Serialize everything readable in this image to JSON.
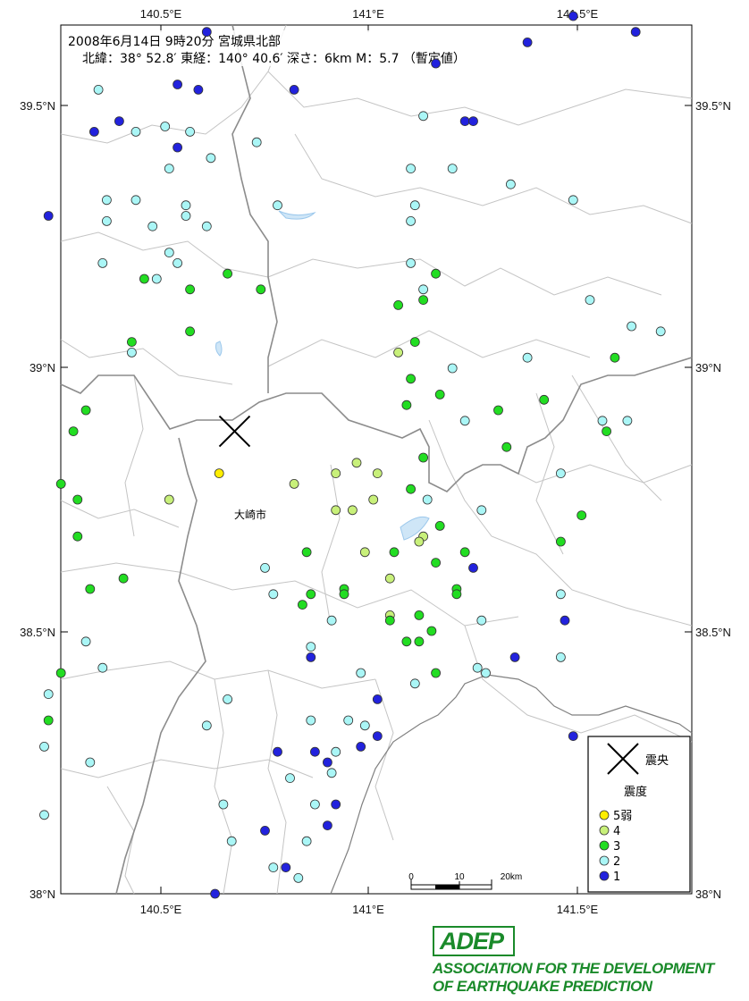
{
  "header": {
    "line1": "2008年6月14日 9時20分  宮城県北部",
    "line2": "北緯：38° 52.8′ 東経：140° 40.6′ 深さ：6km  M：5.7  （暫定値）"
  },
  "axes": {
    "top_ticks": [
      "140.5°E",
      "141°E",
      "141.5°E"
    ],
    "bottom_ticks": [
      "140.5°E",
      "141°E",
      "141.5°E"
    ],
    "left_ticks": [
      "39.5°N",
      "39°N",
      "38.5°N",
      "38°N"
    ],
    "right_ticks": [
      "39.5°N",
      "39°N",
      "38.5°N",
      "38°N"
    ]
  },
  "place_label": "大崎市",
  "epicenter": {
    "lat": 38.88,
    "lon": 140.677
  },
  "legend": {
    "epicenter_label": "震央",
    "intensity_title": "震度",
    "items": [
      {
        "label": "5弱",
        "color": "#ffee00"
      },
      {
        "label": "4",
        "color": "#c8f07a"
      },
      {
        "label": "3",
        "color": "#22dd22"
      },
      {
        "label": "2",
        "color": "#aaf6f6"
      },
      {
        "label": "1",
        "color": "#2222dd"
      }
    ]
  },
  "scale_bar": {
    "labels": [
      "0",
      "10",
      "20km"
    ]
  },
  "logo": {
    "mark": "ADEP",
    "line1": "ASSOCIATION  FOR THE DEVELOPMENT",
    "line2": "OF EARTHQUAKE PREDICTION",
    "color": "#1a8a2a"
  },
  "stations": [
    {
      "lon": 140.61,
      "lat": 39.64,
      "i": 1
    },
    {
      "lon": 141.38,
      "lat": 39.62,
      "i": 1
    },
    {
      "lon": 141.49,
      "lat": 39.67,
      "i": 1
    },
    {
      "lon": 141.64,
      "lat": 39.64,
      "i": 1
    },
    {
      "lon": 140.35,
      "lat": 39.53,
      "i": 2
    },
    {
      "lon": 140.54,
      "lat": 39.54,
      "i": 1
    },
    {
      "lon": 140.59,
      "lat": 39.53,
      "i": 1
    },
    {
      "lon": 140.82,
      "lat": 39.53,
      "i": 1
    },
    {
      "lon": 141.16,
      "lat": 39.58,
      "i": 1
    },
    {
      "lon": 140.4,
      "lat": 39.47,
      "i": 1
    },
    {
      "lon": 140.34,
      "lat": 39.45,
      "i": 1
    },
    {
      "lon": 140.44,
      "lat": 39.45,
      "i": 2
    },
    {
      "lon": 140.51,
      "lat": 39.46,
      "i": 2
    },
    {
      "lon": 140.57,
      "lat": 39.45,
      "i": 2
    },
    {
      "lon": 141.23,
      "lat": 39.47,
      "i": 1
    },
    {
      "lon": 141.25,
      "lat": 39.47,
      "i": 1
    },
    {
      "lon": 141.13,
      "lat": 39.48,
      "i": 2
    },
    {
      "lon": 140.54,
      "lat": 39.42,
      "i": 1
    },
    {
      "lon": 140.73,
      "lat": 39.43,
      "i": 2
    },
    {
      "lon": 140.52,
      "lat": 39.38,
      "i": 2
    },
    {
      "lon": 140.62,
      "lat": 39.4,
      "i": 2
    },
    {
      "lon": 141.1,
      "lat": 39.38,
      "i": 2
    },
    {
      "lon": 141.2,
      "lat": 39.38,
      "i": 2
    },
    {
      "lon": 141.34,
      "lat": 39.35,
      "i": 2
    },
    {
      "lon": 140.37,
      "lat": 39.32,
      "i": 2
    },
    {
      "lon": 140.44,
      "lat": 39.32,
      "i": 2
    },
    {
      "lon": 140.56,
      "lat": 39.31,
      "i": 2
    },
    {
      "lon": 140.23,
      "lat": 39.29,
      "i": 1
    },
    {
      "lon": 140.56,
      "lat": 39.29,
      "i": 2
    },
    {
      "lon": 140.78,
      "lat": 39.31,
      "i": 2
    },
    {
      "lon": 141.11,
      "lat": 39.31,
      "i": 2
    },
    {
      "lon": 141.49,
      "lat": 39.32,
      "i": 2
    },
    {
      "lon": 140.37,
      "lat": 39.28,
      "i": 2
    },
    {
      "lon": 140.48,
      "lat": 39.27,
      "i": 2
    },
    {
      "lon": 140.61,
      "lat": 39.27,
      "i": 2
    },
    {
      "lon": 141.1,
      "lat": 39.28,
      "i": 2
    },
    {
      "lon": 140.52,
      "lat": 39.22,
      "i": 2
    },
    {
      "lon": 140.36,
      "lat": 39.2,
      "i": 2
    },
    {
      "lon": 140.54,
      "lat": 39.2,
      "i": 2
    },
    {
      "lon": 140.66,
      "lat": 39.18,
      "i": 3
    },
    {
      "lon": 141.1,
      "lat": 39.2,
      "i": 2
    },
    {
      "lon": 141.16,
      "lat": 39.18,
      "i": 3
    },
    {
      "lon": 140.46,
      "lat": 39.17,
      "i": 3
    },
    {
      "lon": 140.49,
      "lat": 39.17,
      "i": 2
    },
    {
      "lon": 140.57,
      "lat": 39.15,
      "i": 3
    },
    {
      "lon": 140.74,
      "lat": 39.15,
      "i": 3
    },
    {
      "lon": 141.13,
      "lat": 39.15,
      "i": 2
    },
    {
      "lon": 141.13,
      "lat": 39.13,
      "i": 3
    },
    {
      "lon": 141.53,
      "lat": 39.13,
      "i": 2
    },
    {
      "lon": 141.07,
      "lat": 39.12,
      "i": 3
    },
    {
      "lon": 140.57,
      "lat": 39.07,
      "i": 3
    },
    {
      "lon": 141.63,
      "lat": 39.08,
      "i": 2
    },
    {
      "lon": 141.7,
      "lat": 39.07,
      "i": 2
    },
    {
      "lon": 140.43,
      "lat": 39.05,
      "i": 3
    },
    {
      "lon": 141.11,
      "lat": 39.05,
      "i": 3
    },
    {
      "lon": 140.43,
      "lat": 39.03,
      "i": 2
    },
    {
      "lon": 141.07,
      "lat": 39.03,
      "i": 4
    },
    {
      "lon": 141.38,
      "lat": 39.02,
      "i": 2
    },
    {
      "lon": 141.59,
      "lat": 39.02,
      "i": 3
    },
    {
      "lon": 141.2,
      "lat": 39.0,
      "i": 2
    },
    {
      "lon": 141.1,
      "lat": 38.98,
      "i": 3
    },
    {
      "lon": 141.17,
      "lat": 38.95,
      "i": 3
    },
    {
      "lon": 141.42,
      "lat": 38.94,
      "i": 3
    },
    {
      "lon": 140.32,
      "lat": 38.92,
      "i": 3
    },
    {
      "lon": 141.09,
      "lat": 38.93,
      "i": 3
    },
    {
      "lon": 141.31,
      "lat": 38.92,
      "i": 3
    },
    {
      "lon": 141.23,
      "lat": 38.9,
      "i": 2
    },
    {
      "lon": 141.56,
      "lat": 38.9,
      "i": 2
    },
    {
      "lon": 141.62,
      "lat": 38.9,
      "i": 2
    },
    {
      "lon": 140.29,
      "lat": 38.88,
      "i": 3
    },
    {
      "lon": 141.57,
      "lat": 38.88,
      "i": 3
    },
    {
      "lon": 141.33,
      "lat": 38.85,
      "i": 3
    },
    {
      "lon": 140.97,
      "lat": 38.82,
      "i": 4
    },
    {
      "lon": 141.13,
      "lat": 38.83,
      "i": 3
    },
    {
      "lon": 140.64,
      "lat": 38.8,
      "i": 5
    },
    {
      "lon": 140.92,
      "lat": 38.8,
      "i": 4
    },
    {
      "lon": 141.02,
      "lat": 38.8,
      "i": 4
    },
    {
      "lon": 141.46,
      "lat": 38.8,
      "i": 2
    },
    {
      "lon": 140.26,
      "lat": 38.78,
      "i": 3
    },
    {
      "lon": 140.82,
      "lat": 38.78,
      "i": 4
    },
    {
      "lon": 141.1,
      "lat": 38.77,
      "i": 3
    },
    {
      "lon": 140.3,
      "lat": 38.75,
      "i": 3
    },
    {
      "lon": 140.52,
      "lat": 38.75,
      "i": 4
    },
    {
      "lon": 141.01,
      "lat": 38.75,
      "i": 4
    },
    {
      "lon": 141.14,
      "lat": 38.75,
      "i": 2
    },
    {
      "lon": 140.92,
      "lat": 38.73,
      "i": 4
    },
    {
      "lon": 140.96,
      "lat": 38.73,
      "i": 4
    },
    {
      "lon": 141.27,
      "lat": 38.73,
      "i": 2
    },
    {
      "lon": 141.51,
      "lat": 38.72,
      "i": 3
    },
    {
      "lon": 141.17,
      "lat": 38.7,
      "i": 3
    },
    {
      "lon": 140.3,
      "lat": 38.68,
      "i": 3
    },
    {
      "lon": 141.13,
      "lat": 38.68,
      "i": 4
    },
    {
      "lon": 141.12,
      "lat": 38.67,
      "i": 4
    },
    {
      "lon": 141.46,
      "lat": 38.67,
      "i": 3
    },
    {
      "lon": 140.85,
      "lat": 38.65,
      "i": 3
    },
    {
      "lon": 140.99,
      "lat": 38.65,
      "i": 4
    },
    {
      "lon": 141.06,
      "lat": 38.65,
      "i": 3
    },
    {
      "lon": 141.23,
      "lat": 38.65,
      "i": 3
    },
    {
      "lon": 141.16,
      "lat": 38.63,
      "i": 3
    },
    {
      "lon": 140.75,
      "lat": 38.62,
      "i": 2
    },
    {
      "lon": 141.25,
      "lat": 38.62,
      "i": 1
    },
    {
      "lon": 140.41,
      "lat": 38.6,
      "i": 3
    },
    {
      "lon": 141.05,
      "lat": 38.6,
      "i": 4
    },
    {
      "lon": 140.33,
      "lat": 38.58,
      "i": 3
    },
    {
      "lon": 140.94,
      "lat": 38.58,
      "i": 3
    },
    {
      "lon": 141.21,
      "lat": 38.58,
      "i": 3
    },
    {
      "lon": 140.77,
      "lat": 38.57,
      "i": 2
    },
    {
      "lon": 140.86,
      "lat": 38.57,
      "i": 3
    },
    {
      "lon": 140.94,
      "lat": 38.57,
      "i": 3
    },
    {
      "lon": 141.21,
      "lat": 38.57,
      "i": 3
    },
    {
      "lon": 141.46,
      "lat": 38.57,
      "i": 2
    },
    {
      "lon": 140.84,
      "lat": 38.55,
      "i": 3
    },
    {
      "lon": 141.05,
      "lat": 38.53,
      "i": 4
    },
    {
      "lon": 141.12,
      "lat": 38.53,
      "i": 3
    },
    {
      "lon": 140.91,
      "lat": 38.52,
      "i": 2
    },
    {
      "lon": 141.05,
      "lat": 38.52,
      "i": 3
    },
    {
      "lon": 141.27,
      "lat": 38.52,
      "i": 2
    },
    {
      "lon": 141.47,
      "lat": 38.52,
      "i": 1
    },
    {
      "lon": 141.15,
      "lat": 38.5,
      "i": 3
    },
    {
      "lon": 140.32,
      "lat": 38.48,
      "i": 2
    },
    {
      "lon": 141.09,
      "lat": 38.48,
      "i": 3
    },
    {
      "lon": 141.12,
      "lat": 38.48,
      "i": 3
    },
    {
      "lon": 140.86,
      "lat": 38.47,
      "i": 2
    },
    {
      "lon": 140.86,
      "lat": 38.45,
      "i": 1
    },
    {
      "lon": 141.35,
      "lat": 38.45,
      "i": 1
    },
    {
      "lon": 141.46,
      "lat": 38.45,
      "i": 2
    },
    {
      "lon": 140.36,
      "lat": 38.43,
      "i": 2
    },
    {
      "lon": 141.26,
      "lat": 38.43,
      "i": 2
    },
    {
      "lon": 140.26,
      "lat": 38.42,
      "i": 3
    },
    {
      "lon": 140.98,
      "lat": 38.42,
      "i": 2
    },
    {
      "lon": 141.16,
      "lat": 38.42,
      "i": 3
    },
    {
      "lon": 141.28,
      "lat": 38.42,
      "i": 2
    },
    {
      "lon": 141.11,
      "lat": 38.4,
      "i": 2
    },
    {
      "lon": 140.23,
      "lat": 38.38,
      "i": 2
    },
    {
      "lon": 140.66,
      "lat": 38.37,
      "i": 2
    },
    {
      "lon": 141.02,
      "lat": 38.37,
      "i": 1
    },
    {
      "lon": 140.23,
      "lat": 38.33,
      "i": 3
    },
    {
      "lon": 140.86,
      "lat": 38.33,
      "i": 2
    },
    {
      "lon": 140.95,
      "lat": 38.33,
      "i": 2
    },
    {
      "lon": 140.61,
      "lat": 38.32,
      "i": 2
    },
    {
      "lon": 140.99,
      "lat": 38.32,
      "i": 2
    },
    {
      "lon": 141.02,
      "lat": 38.3,
      "i": 1
    },
    {
      "lon": 141.49,
      "lat": 38.3,
      "i": 1
    },
    {
      "lon": 140.22,
      "lat": 38.28,
      "i": 2
    },
    {
      "lon": 140.98,
      "lat": 38.28,
      "i": 1
    },
    {
      "lon": 140.78,
      "lat": 38.27,
      "i": 1
    },
    {
      "lon": 140.87,
      "lat": 38.27,
      "i": 1
    },
    {
      "lon": 140.92,
      "lat": 38.27,
      "i": 2
    },
    {
      "lon": 140.33,
      "lat": 38.25,
      "i": 2
    },
    {
      "lon": 140.9,
      "lat": 38.25,
      "i": 1
    },
    {
      "lon": 140.91,
      "lat": 38.23,
      "i": 2
    },
    {
      "lon": 140.81,
      "lat": 38.22,
      "i": 2
    },
    {
      "lon": 140.87,
      "lat": 38.17,
      "i": 2
    },
    {
      "lon": 140.65,
      "lat": 38.17,
      "i": 2
    },
    {
      "lon": 140.92,
      "lat": 38.17,
      "i": 1
    },
    {
      "lon": 140.22,
      "lat": 38.15,
      "i": 2
    },
    {
      "lon": 140.9,
      "lat": 38.13,
      "i": 1
    },
    {
      "lon": 140.75,
      "lat": 38.12,
      "i": 1
    },
    {
      "lon": 140.67,
      "lat": 38.1,
      "i": 2
    },
    {
      "lon": 140.85,
      "lat": 38.1,
      "i": 2
    },
    {
      "lon": 140.77,
      "lat": 38.05,
      "i": 2
    },
    {
      "lon": 140.8,
      "lat": 38.05,
      "i": 1
    },
    {
      "lon": 140.83,
      "lat": 38.03,
      "i": 2
    },
    {
      "lon": 140.63,
      "lat": 38.0,
      "i": 1
    }
  ]
}
